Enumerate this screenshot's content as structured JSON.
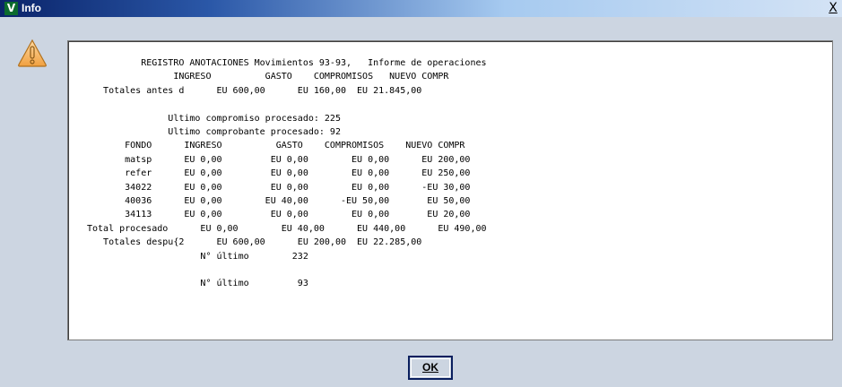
{
  "window": {
    "title": "Info",
    "close_label": "X"
  },
  "dialog": {
    "icon": "warning-icon",
    "ok_label": "OK"
  },
  "report": {
    "lines": [
      "          REGISTRO ANOTACIONES Movimientos 93-93,   Informe de operaciones",
      "                INGRESO          GASTO    COMPROMISOS   NUEVO COMPR",
      "   Totales antes d      EU 600,00      EU 160,00  EU 21.845,00",
      "",
      "               Ultimo compromiso procesado: 225",
      "               Ultimo comprobante procesado: 92",
      "       FONDO      INGRESO          GASTO    COMPROMISOS    NUEVO COMPR",
      "       matsp      EU 0,00         EU 0,00        EU 0,00      EU 200,00",
      "       refer      EU 0,00         EU 0,00        EU 0,00      EU 250,00",
      "       34022      EU 0,00         EU 0,00        EU 0,00      -EU 30,00",
      "       40036      EU 0,00        EU 40,00      -EU 50,00       EU 50,00",
      "       34113      EU 0,00         EU 0,00        EU 0,00       EU 20,00",
      "Total procesado      EU 0,00        EU 40,00      EU 440,00      EU 490,00",
      "   Totales despu{2      EU 600,00      EU 200,00  EU 22.285,00",
      "                     N° último        232",
      "",
      "                     N° último         93"
    ]
  }
}
